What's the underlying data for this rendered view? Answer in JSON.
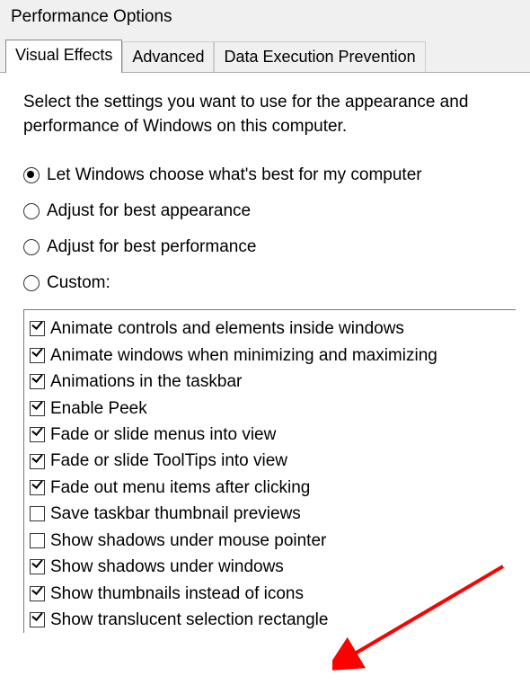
{
  "window": {
    "title": "Performance Options"
  },
  "tabs": [
    {
      "label": "Visual Effects",
      "active": true
    },
    {
      "label": "Advanced",
      "active": false
    },
    {
      "label": "Data Execution Prevention",
      "active": false
    }
  ],
  "description": "Select the settings you want to use for the appearance and performance of Windows on this computer.",
  "radios": [
    {
      "label": "Let Windows choose what's best for my computer",
      "selected": true
    },
    {
      "label": "Adjust for best appearance",
      "selected": false
    },
    {
      "label": "Adjust for best performance",
      "selected": false
    },
    {
      "label": "Custom:",
      "selected": false
    }
  ],
  "checks": [
    {
      "label": "Animate controls and elements inside windows",
      "checked": true
    },
    {
      "label": "Animate windows when minimizing and maximizing",
      "checked": true
    },
    {
      "label": "Animations in the taskbar",
      "checked": true
    },
    {
      "label": "Enable Peek",
      "checked": true
    },
    {
      "label": "Fade or slide menus into view",
      "checked": true
    },
    {
      "label": "Fade or slide ToolTips into view",
      "checked": true
    },
    {
      "label": "Fade out menu items after clicking",
      "checked": true
    },
    {
      "label": "Save taskbar thumbnail previews",
      "checked": false
    },
    {
      "label": "Show shadows under mouse pointer",
      "checked": false
    },
    {
      "label": "Show shadows under windows",
      "checked": true
    },
    {
      "label": "Show thumbnails instead of icons",
      "checked": true
    },
    {
      "label": "Show translucent selection rectangle",
      "checked": true
    }
  ]
}
